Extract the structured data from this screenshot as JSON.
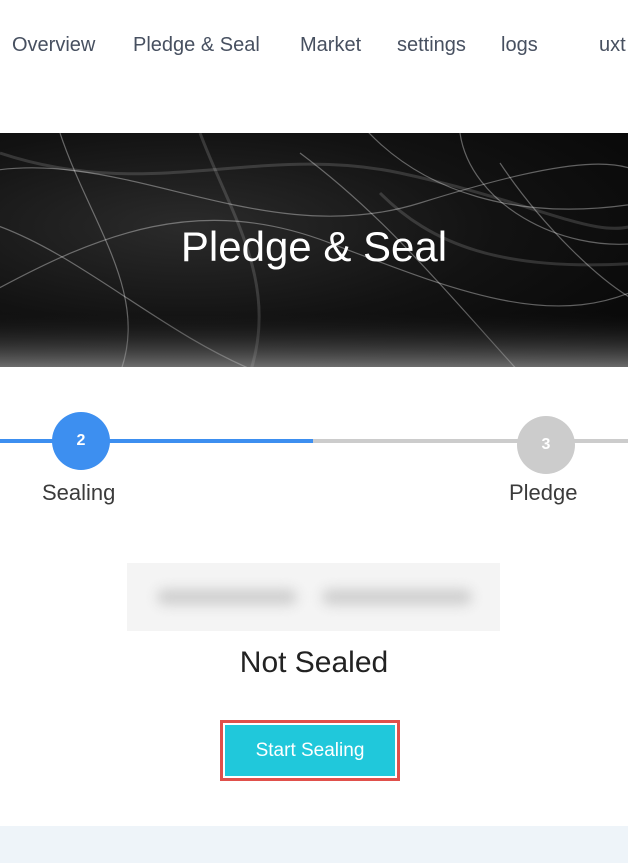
{
  "nav": {
    "items": [
      {
        "label": "Overview"
      },
      {
        "label": "Pledge & Seal"
      },
      {
        "label": "Market"
      },
      {
        "label": "settings"
      },
      {
        "label": "logs"
      },
      {
        "label": "uxt"
      }
    ]
  },
  "hero": {
    "title": "Pledge & Seal"
  },
  "stepper": {
    "steps": [
      {
        "number": "2",
        "label": "Sealing",
        "state": "active"
      },
      {
        "number": "3",
        "label": "Pledge",
        "state": "pending"
      }
    ],
    "colors": {
      "active": "#3d8ff0",
      "pending": "#cccccc"
    }
  },
  "status": {
    "text": "Not Sealed"
  },
  "actions": {
    "start_label": "Start Sealing"
  },
  "colors": {
    "accent": "#20c8db",
    "highlight_border": "#e0504b"
  }
}
